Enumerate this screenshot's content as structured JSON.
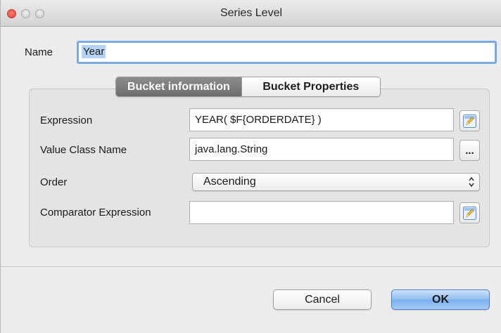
{
  "window": {
    "title": "Series Level"
  },
  "name_field": {
    "label": "Name",
    "value": "Year"
  },
  "tabs": [
    {
      "label": "Bucket information",
      "active": true
    },
    {
      "label": "Bucket Properties",
      "active": false
    }
  ],
  "form": {
    "expression": {
      "label": "Expression",
      "value": "YEAR( $F{ORDERDATE} )"
    },
    "value_class": {
      "label": "Value Class Name",
      "value": "java.lang.String",
      "button": "..."
    },
    "order": {
      "label": "Order",
      "value": "Ascending"
    },
    "comparator": {
      "label": "Comparator Expression",
      "value": ""
    }
  },
  "buttons": {
    "cancel": "Cancel",
    "ok": "OK"
  },
  "icons": {
    "expression_edit": "edit-expression-icon",
    "comparator_edit": "edit-expression-icon",
    "select_arrows": "up-down-chevron-icon"
  },
  "colors": {
    "focus_ring": "#7aa8e0",
    "selection": "#b4d3f6",
    "default_button": "#8ebcf2",
    "close_button": "#e0443a"
  }
}
